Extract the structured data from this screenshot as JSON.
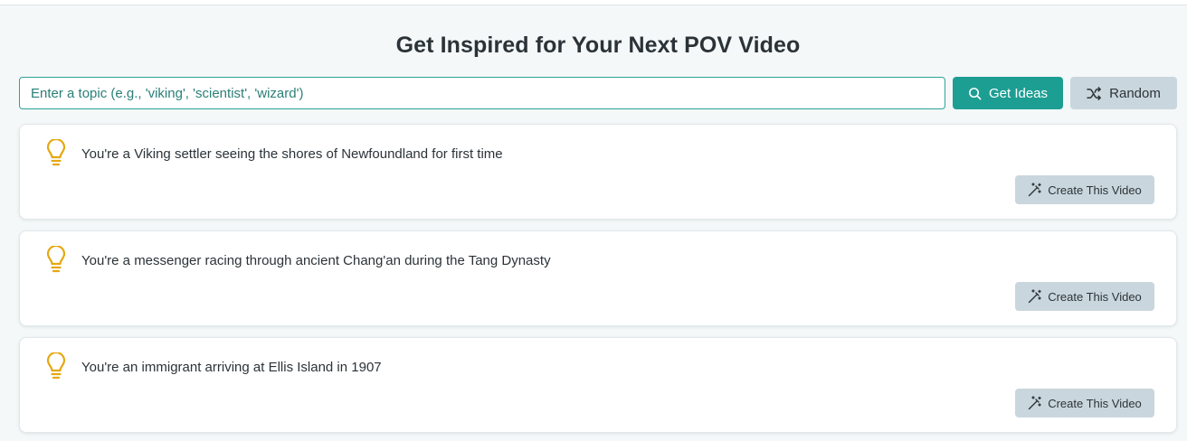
{
  "header": {
    "title": "Get Inspired for Your Next POV Video"
  },
  "search": {
    "placeholder": "Enter a topic (e.g., 'viking', 'scientist', 'wizard')",
    "value": "",
    "get_ideas_label": "Get Ideas",
    "random_label": "Random"
  },
  "ideas": [
    {
      "text": "You're a Viking settler seeing the shores of Newfoundland for first time",
      "button_label": "Create This Video"
    },
    {
      "text": "You're a messenger racing through ancient Chang'an during the Tang Dynasty",
      "button_label": "Create This Video"
    },
    {
      "text": "You're an immigrant arriving at Ellis Island in 1907",
      "button_label": "Create This Video"
    }
  ],
  "icons": {
    "idea": "lightbulb-icon",
    "search": "search-icon",
    "random": "shuffle-icon",
    "create": "magic-wand-icon"
  },
  "colors": {
    "accent": "#1d9e93",
    "bulb": "#e5a810",
    "secondary_button": "#cad6dd",
    "background": "#f4f8f8"
  }
}
